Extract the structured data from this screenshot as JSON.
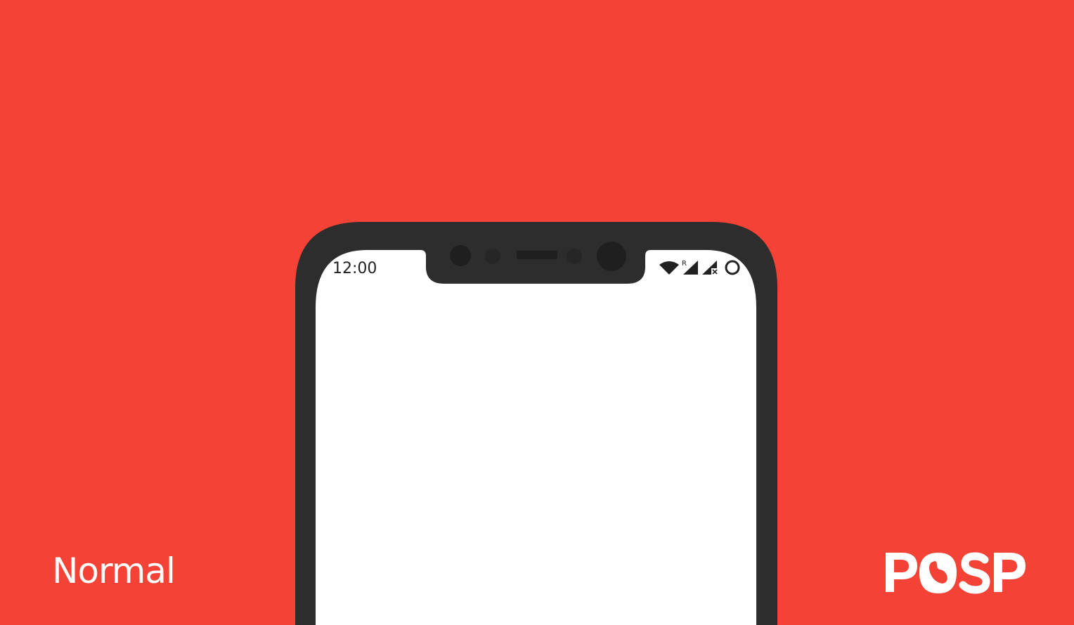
{
  "background_color": "#f44336",
  "phone": {
    "frame_color": "#2d2d2d",
    "screen_color": "#ffffff",
    "status_bar": {
      "time": "12:00",
      "roaming_label": "R",
      "icons": [
        "wifi-icon",
        "signal-roaming-icon",
        "signal-no-data-icon",
        "battery-ring-icon"
      ]
    },
    "notch_elements": [
      "front-camera-left",
      "proximity-sensor",
      "earpiece-speaker",
      "ambient-sensor",
      "front-camera-right"
    ]
  },
  "caption": {
    "text": "Normal"
  },
  "logo": {
    "text": "POSP",
    "color": "#ffffff"
  }
}
